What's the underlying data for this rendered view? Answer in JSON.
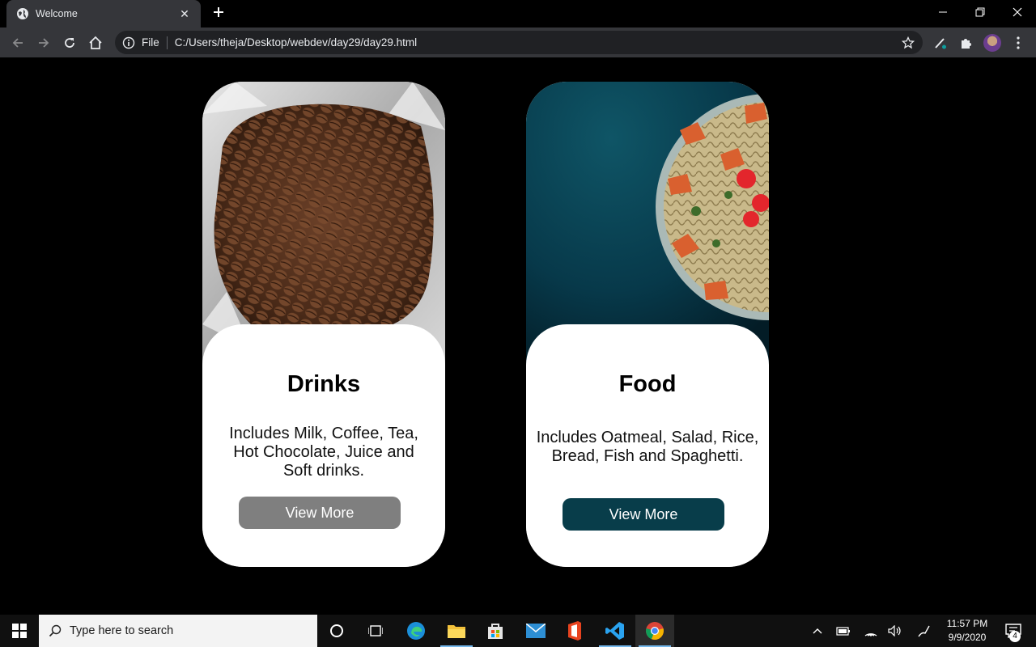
{
  "browser": {
    "tab_title": "Welcome",
    "new_tab_icon": "plus-icon",
    "omnibox": {
      "scheme_label": "File",
      "url": "C:/Users/theja/Desktop/webdev/day29/day29.html"
    }
  },
  "page": {
    "cards": [
      {
        "title": "Drinks",
        "description": "Includes Milk, Coffee, Tea, Hot Chocolate, Juice and Soft drinks.",
        "button_label": "View More",
        "button_color": "#7f7f7f",
        "image": "coffee-beans-in-bag"
      },
      {
        "title": "Food",
        "description": "Includes Oatmeal, Salad, Rice, Bread, Fish and Spaghetti.",
        "button_label": "View More",
        "button_color": "#083d4a",
        "image": "pasta-bowl-on-teal"
      }
    ]
  },
  "taskbar": {
    "search_placeholder": "Type here to search",
    "clock_time": "11:57 PM",
    "clock_date": "9/9/2020",
    "notification_count": "4"
  },
  "colors": {
    "page_background": "#000000",
    "card_background": "#ffffff",
    "browser_chrome": "#35363a",
    "accent_taskbar": "#76b9ed"
  }
}
